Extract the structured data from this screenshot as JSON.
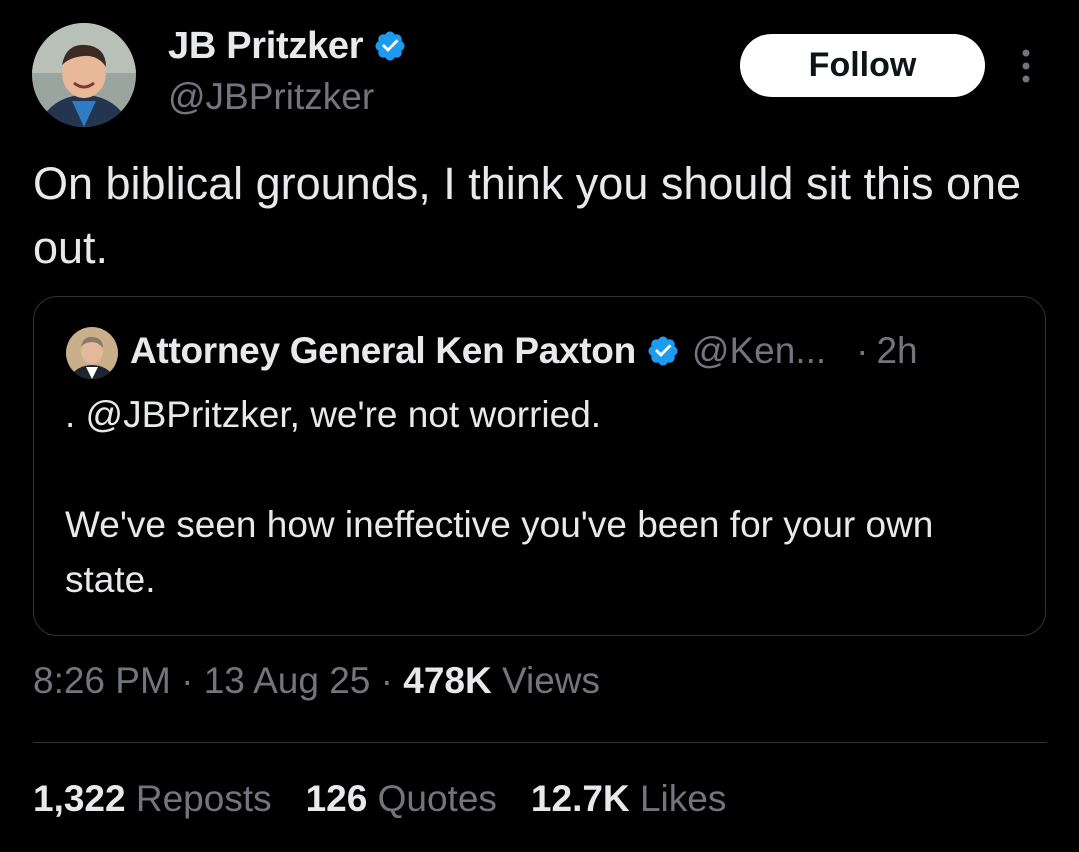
{
  "colors": {
    "background": "#000000",
    "primary_text": "#e7e9ea",
    "secondary_text": "#71767b",
    "verified_blue": "#1d9bf0",
    "border": "#2f3336",
    "follow_button_bg": "#ffffff"
  },
  "author": {
    "name": "JB Pritzker",
    "handle": "@JBPritzker",
    "verified": true
  },
  "follow_label": "Follow",
  "more_icon": "more-vertical-icon",
  "tweet": {
    "text": "On biblical grounds, I think you should sit this one out."
  },
  "quote": {
    "name": "Attorney General Ken Paxton",
    "handle": "@Ken...",
    "separator": "·",
    "time": "2h",
    "verified": true,
    "text": ". @JBPritzker, we're not worried.\n\nWe've seen how ineffective you've been for your own state."
  },
  "meta": {
    "time": "8:26 PM",
    "date": "13 Aug 25",
    "views_count": "478K",
    "views_label": "Views",
    "separator": "·"
  },
  "stats": {
    "reposts_count": "1,322",
    "reposts_label": "Reposts",
    "quotes_count": "126",
    "quotes_label": "Quotes",
    "likes_count": "12.7K",
    "likes_label": "Likes"
  }
}
